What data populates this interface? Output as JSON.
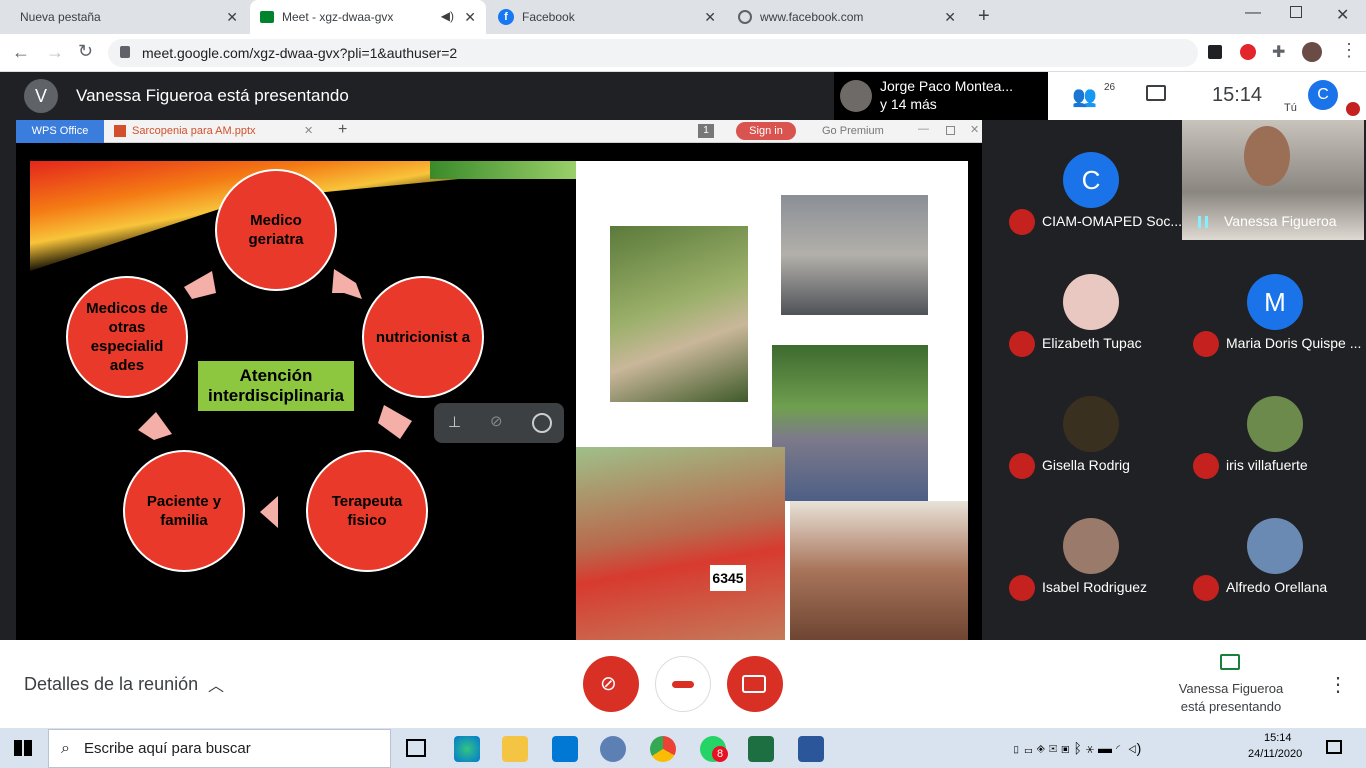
{
  "browser": {
    "tabs": [
      {
        "label": "Nueva pestaña",
        "icon": "blank"
      },
      {
        "label": "Meet - xgz-dwaa-gvx",
        "icon": "meet-icon"
      },
      {
        "label": "Facebook",
        "icon": "facebook-icon"
      },
      {
        "label": "www.facebook.com",
        "icon": "globe-icon"
      }
    ],
    "url": "meet.google.com/xgz-dwaa-gvx?pli=1&authuser=2"
  },
  "meet": {
    "presenter_initial": "V",
    "presenting_text": "Vanessa Figueroa está presentando",
    "pinned_name": "Jorge Paco Montea...",
    "pinned_more": "y 14 más",
    "participant_count": "26",
    "clock": "15:14",
    "you_label": "Tú",
    "you_initial": "C"
  },
  "wps": {
    "brand": "WPS Office",
    "file": "Sarcopenia para AM.pptx",
    "page": "1",
    "signin": "Sign in",
    "premium": "Go Premium"
  },
  "slide": {
    "center": "Atención interdisciplinaria",
    "circles": [
      "Medico geriatra",
      "nutricionist a",
      "Terapeuta fisico",
      "Paciente y familia",
      "Medicos de otras especialid ades"
    ],
    "bib": "6345"
  },
  "participants": [
    {
      "name": "CIAM-OMAPED Soc...",
      "initial": "C",
      "color": "#1a73e8",
      "muted": true
    },
    {
      "name": "Vanessa Figueroa",
      "video": true,
      "muted": false
    },
    {
      "name": "Elizabeth Tupac",
      "photo": true,
      "muted": true
    },
    {
      "name": "Maria Doris Quispe ...",
      "initial": "M",
      "color": "#1a73e8",
      "muted": true
    },
    {
      "name": "Gisella Rodrig",
      "photo": true,
      "muted": true
    },
    {
      "name": "iris villafuerte",
      "photo": true,
      "muted": true
    },
    {
      "name": "Isabel Rodriguez",
      "photo": true,
      "muted": true
    },
    {
      "name": "Alfredo Orellana",
      "photo": true,
      "muted": true
    }
  ],
  "bottom": {
    "details": "Detalles de la reunión",
    "presenting": "Vanessa Figueroa está presentando"
  },
  "taskbar": {
    "search_placeholder": "Escribe aquí para buscar",
    "time": "15:14",
    "date": "24/11/2020",
    "whatsapp_badge": "8"
  }
}
